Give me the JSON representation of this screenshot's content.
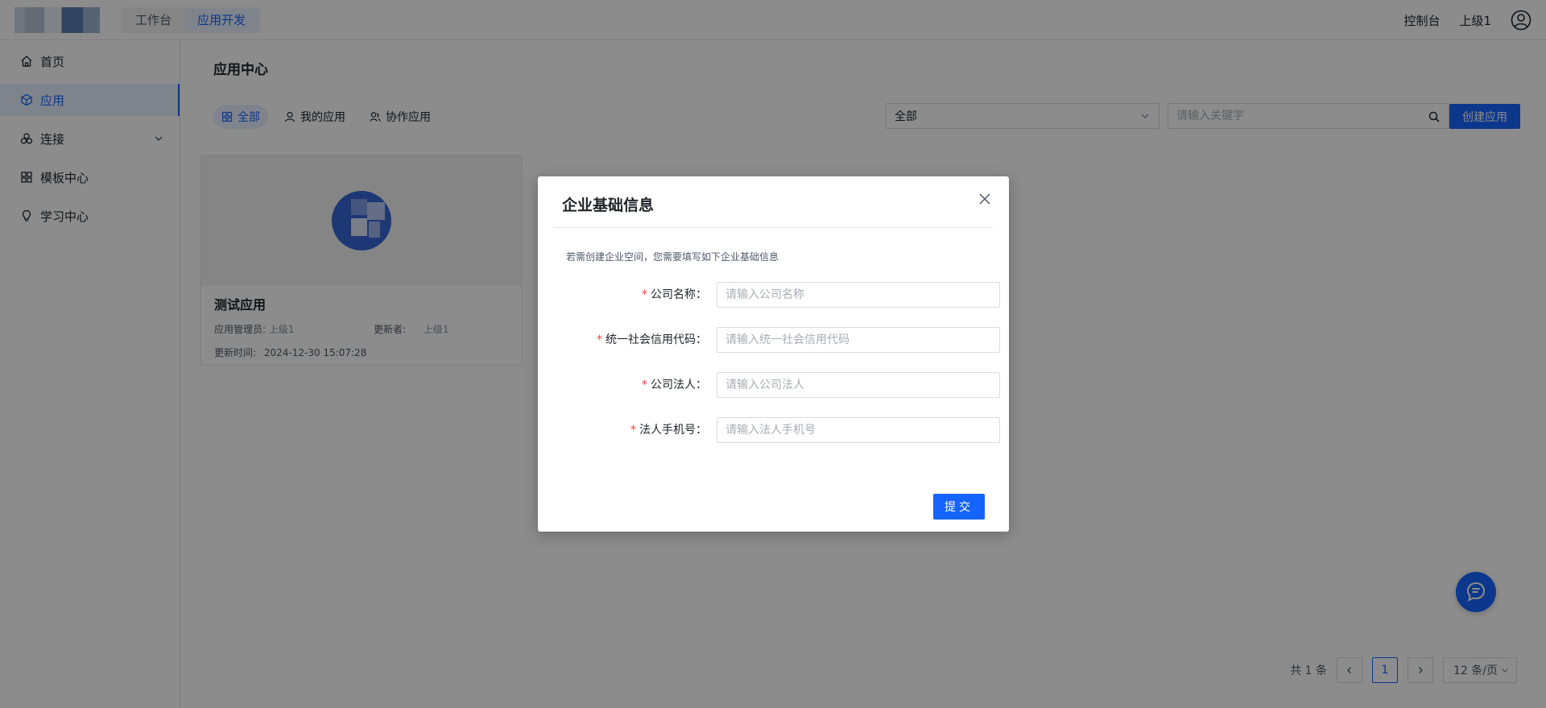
{
  "header": {
    "tabs": [
      {
        "label": "工作台"
      },
      {
        "label": "应用开发"
      }
    ],
    "console_label": "控制台",
    "user_name": "上级1"
  },
  "sidebar": {
    "items": [
      {
        "label": "首页",
        "icon": "home-icon"
      },
      {
        "label": "应用",
        "icon": "cube-icon"
      },
      {
        "label": "连接",
        "icon": "connect-icon"
      },
      {
        "label": "模板中心",
        "icon": "grid-icon"
      },
      {
        "label": "学习中心",
        "icon": "bulb-icon"
      }
    ]
  },
  "main": {
    "title": "应用中心",
    "filters": [
      {
        "label": "全部"
      },
      {
        "label": "我的应用"
      },
      {
        "label": "协作应用"
      }
    ],
    "select_value": "全部",
    "search_placeholder": "请输入关键字",
    "create_label": "创建应用",
    "card": {
      "title": "测试应用",
      "admin_label": "应用管理员:",
      "admin_value": "上级1",
      "updater_label": "更新者:",
      "updater_value": "上级1",
      "time_label": "更新时间:",
      "time_value": "2024-12-30 15:07:28"
    },
    "pagination": {
      "total": "共 1 条",
      "current_page": "1",
      "page_size": "12 条/页"
    }
  },
  "modal": {
    "title": "企业基础信息",
    "tip": "若需创建企业空间，您需要填写如下企业基础信息",
    "fields": [
      {
        "label": "公司名称：",
        "placeholder": "请输入公司名称"
      },
      {
        "label": "统一社会信用代码：",
        "placeholder": "请输入统一社会信用代码"
      },
      {
        "label": "公司法人：",
        "placeholder": "请输入公司法人"
      },
      {
        "label": "法人手机号：",
        "placeholder": "请输入法人手机号"
      }
    ],
    "submit_label": "提交"
  },
  "colors": {
    "primary": "#1664ff",
    "required": "#f53f3f"
  }
}
